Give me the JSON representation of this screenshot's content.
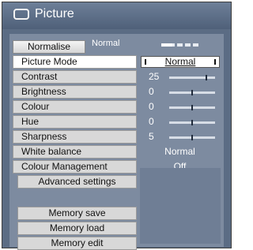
{
  "window": {
    "title": "Picture",
    "icon": "monitor-icon"
  },
  "header": {
    "tab_label": "Normalise",
    "mode_value": "Normal"
  },
  "menu": {
    "picture_mode": {
      "label": "Picture Mode",
      "value": "Normal"
    },
    "contrast": {
      "label": "Contrast",
      "value": "25",
      "level": 0.83
    },
    "brightness": {
      "label": "Brightness",
      "value": "0",
      "level": 0.5
    },
    "colour": {
      "label": "Colour",
      "value": "0",
      "level": 0.5
    },
    "hue": {
      "label": "Hue",
      "value": "0",
      "level": 0.5
    },
    "sharpness": {
      "label": "Sharpness",
      "value": "5",
      "level": 0.5
    },
    "white_balance": {
      "label": "White balance",
      "value": "Normal"
    },
    "colour_management": {
      "label": "Colour Management",
      "value": "Off"
    },
    "advanced": {
      "label": "Advanced settings"
    }
  },
  "memory": {
    "save": "Memory save",
    "load": "Memory load",
    "edit": "Memory edit"
  },
  "colors": {
    "background": "#5b6c84",
    "panel": "#7d8ba0",
    "button": "#d8d8d8",
    "selected": "#ffffff"
  }
}
